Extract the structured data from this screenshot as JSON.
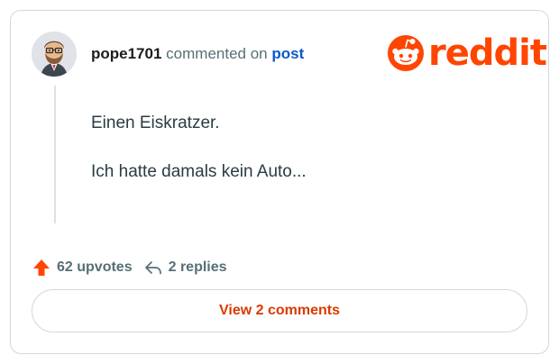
{
  "comment": {
    "username": "pope1701",
    "action_text": "commented on",
    "link_text": "post",
    "paragraphs": [
      "Einen Eiskratzer.",
      "Ich hatte damals kein Auto..."
    ]
  },
  "brand": {
    "wordmark": "reddit",
    "color": "#ff4500"
  },
  "footer": {
    "upvotes": "62 upvotes",
    "replies": "2 replies",
    "view_comments_label": "View 2 comments"
  },
  "icons": {
    "avatar": "bearded-glasses-character-avatar",
    "upvote": "upvote-arrow-icon",
    "reply": "reply-arrow-icon",
    "logo": "reddit-snoo-icon"
  }
}
